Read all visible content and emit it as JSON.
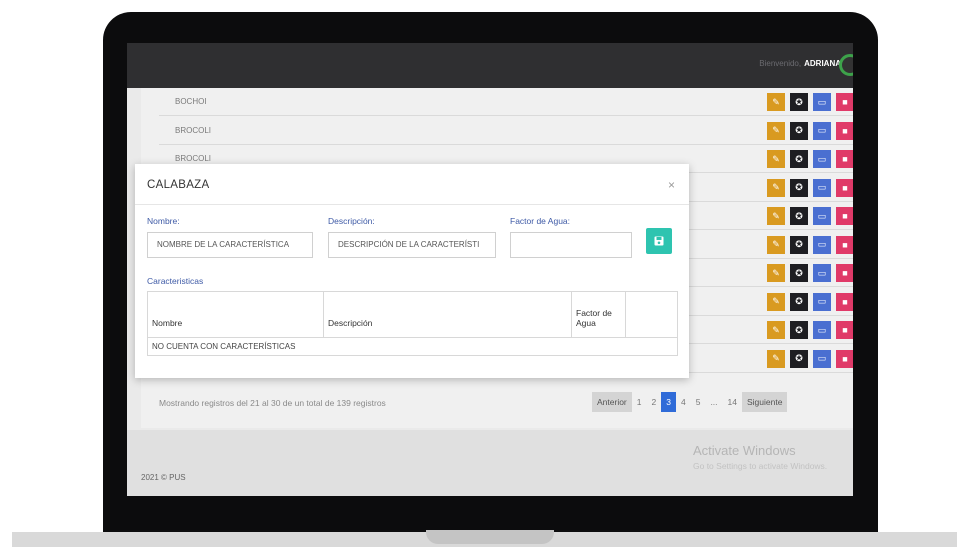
{
  "header": {
    "welcome_text": "Bienvenido,",
    "user_name": "ADRIANA"
  },
  "list": {
    "rows": [
      {
        "name": "BOCHOI"
      },
      {
        "name": "BROCOLI"
      },
      {
        "name": "BROCOLI"
      },
      {
        "name": ""
      },
      {
        "name": ""
      },
      {
        "name": ""
      },
      {
        "name": ""
      },
      {
        "name": ""
      },
      {
        "name": ""
      },
      {
        "name": ""
      }
    ],
    "action_icons": [
      "edit-icon",
      "award-icon",
      "view-icon",
      "trash-icon"
    ]
  },
  "footer": {
    "records_info": "Mostrando registros del 21 al 30 de un total de 139 registros",
    "copyright": "2021 © PUS"
  },
  "pagination": {
    "previous": "Anterior",
    "pages": [
      "1",
      "2",
      "3",
      "4",
      "5",
      "...",
      "14"
    ],
    "active_page": "3",
    "next": "Siguiente"
  },
  "watermark": {
    "title": "Activate Windows",
    "subtitle": "Go to Settings to activate Windows."
  },
  "modal": {
    "title": "CALABAZA",
    "close": "×",
    "fields": {
      "nombre_label": "Nombre:",
      "nombre_placeholder": "NOMBRE DE LA CARACTERÍSTICA",
      "descripcion_label": "Descripción:",
      "descripcion_placeholder": "DESCRIPCIÓN DE LA CARACTERÍSTI",
      "factor_label": "Factor de Agua:",
      "factor_value": ""
    },
    "section_title": "Caracteristicas",
    "table": {
      "headers": [
        "Nombre",
        "Descripción",
        "Factor de Agua",
        ""
      ],
      "empty_message": "NO CUENTA CON CARACTERÍSTICAS"
    }
  },
  "colors": {
    "edit": "#d99a20",
    "award": "#1e1e22",
    "view": "#4a6fd1",
    "delete": "#e03a68",
    "save": "#2ec4b0",
    "active_page": "#2f6bd8",
    "label": "#3e5aa6"
  }
}
